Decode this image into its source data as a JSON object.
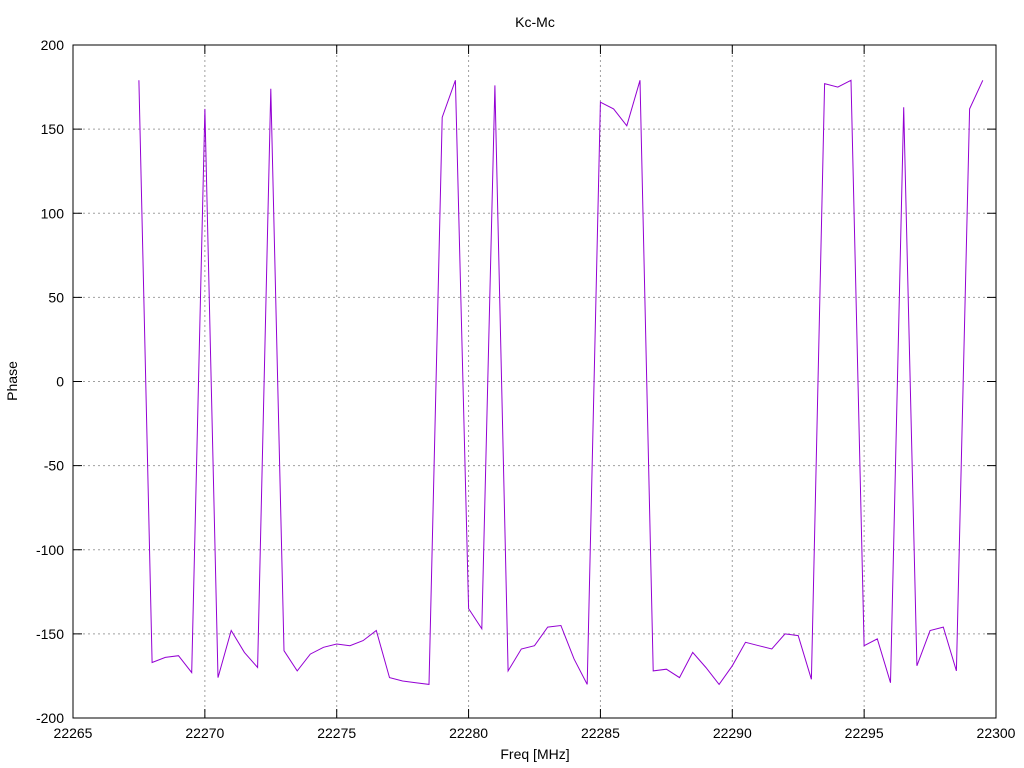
{
  "chart_data": {
    "type": "line",
    "title": "Kc-Mc",
    "xlabel": "Freq [MHz]",
    "ylabel": "Phase",
    "xlim": [
      22265,
      22300
    ],
    "ylim": [
      -200,
      200
    ],
    "x_ticks": [
      22265,
      22270,
      22275,
      22280,
      22285,
      22290,
      22295,
      22300
    ],
    "y_ticks": [
      -200,
      -150,
      -100,
      -50,
      0,
      50,
      100,
      150,
      200
    ],
    "grid": true,
    "legend": "none",
    "series": [
      {
        "color": "#9400d3",
        "x": [
          22267.5,
          22268.0,
          22268.5,
          22269.0,
          22269.5,
          22270.0,
          22270.5,
          22271.0,
          22271.5,
          22272.0,
          22272.5,
          22273.0,
          22273.5,
          22274.0,
          22274.5,
          22275.0,
          22275.5,
          22276.0,
          22276.5,
          22277.0,
          22277.5,
          22278.0,
          22278.5,
          22279.0,
          22279.5,
          22280.0,
          22280.5,
          22281.0,
          22281.5,
          22282.0,
          22282.5,
          22283.0,
          22283.5,
          22284.0,
          22284.5,
          22285.0,
          22285.5,
          22286.0,
          22286.5,
          22287.0,
          22287.5,
          22288.0,
          22288.5,
          22289.0,
          22289.5,
          22290.0,
          22290.5,
          22291.0,
          22291.5,
          22292.0,
          22292.5,
          22293.0,
          22293.5,
          22294.0,
          22294.5,
          22295.0,
          22295.5,
          22296.0,
          22296.5,
          22297.0,
          22297.5,
          22298.0,
          22298.5,
          22299.0,
          22299.5
        ],
        "y": [
          179,
          -167,
          -164,
          -163,
          -173,
          162,
          -176,
          -148,
          -161,
          -170,
          174,
          -160,
          -172,
          -162,
          -158,
          -156,
          -157,
          -154,
          -148,
          -176,
          -178,
          -179,
          -180,
          157,
          179,
          -135,
          -147,
          176,
          -172,
          -159,
          -157,
          -146,
          -145,
          -165,
          -180,
          166,
          162,
          152,
          179,
          -172,
          -171,
          -176,
          -161,
          -170,
          -180,
          -169,
          -155,
          -157,
          -159,
          -150,
          -151,
          -177,
          177,
          175,
          179,
          -157,
          -153,
          -179,
          163,
          -169,
          -148,
          -146,
          -172,
          162,
          179
        ]
      }
    ]
  }
}
